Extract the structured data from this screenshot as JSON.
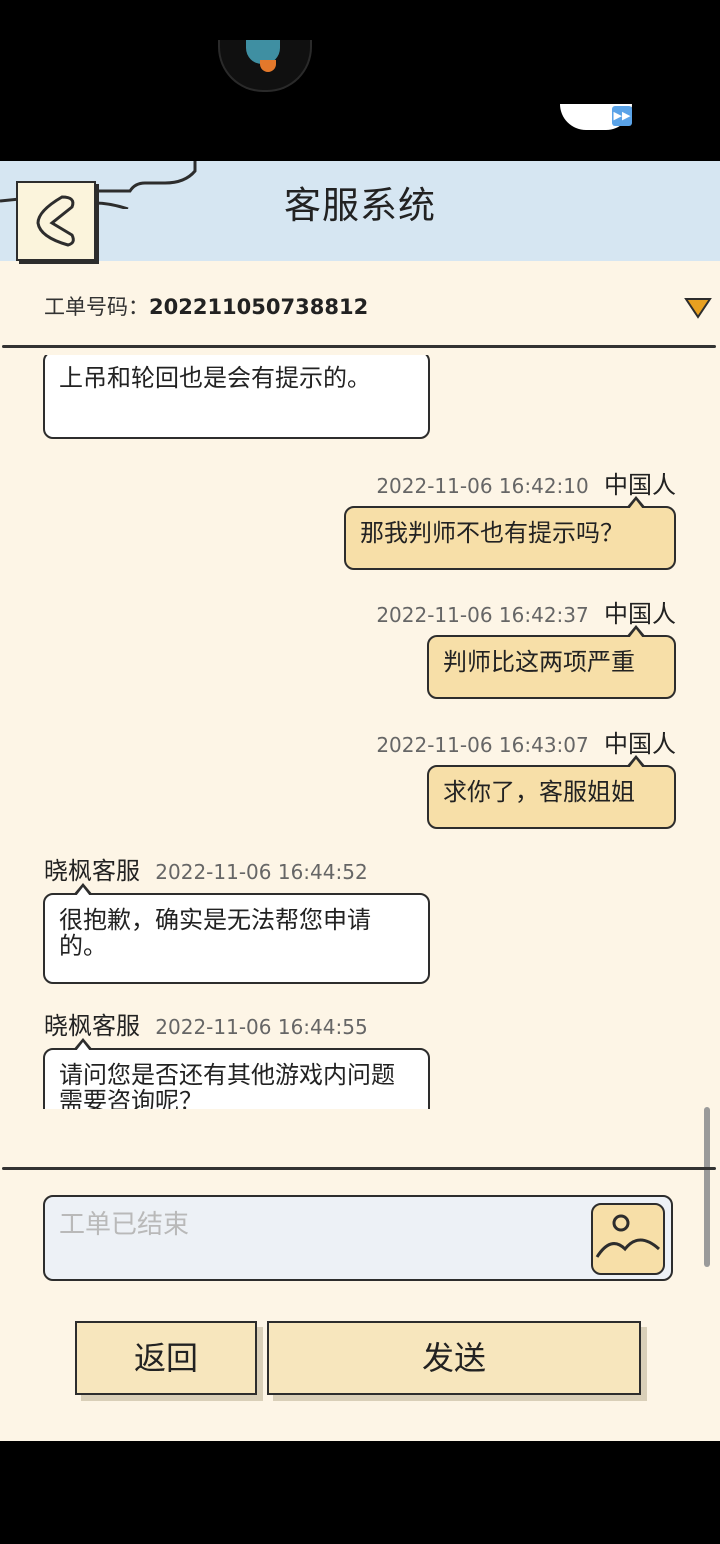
{
  "header": {
    "title": "客服系统"
  },
  "ticket": {
    "label": "工单号码：",
    "number": "202211050738812"
  },
  "messages": [
    {
      "side": "left",
      "text": "上吊和轮回也是会有提示的。"
    },
    {
      "side": "right",
      "sender": "中国人",
      "time": "2022-11-06 16:42:10",
      "text": "那我判师不也有提示吗？"
    },
    {
      "side": "right",
      "sender": "中国人",
      "time": "2022-11-06 16:42:37",
      "text": "判师比这两项严重"
    },
    {
      "side": "right",
      "sender": "中国人",
      "time": "2022-11-06 16:43:07",
      "text": "求你了，客服姐姐"
    },
    {
      "side": "left",
      "sender": "晓枫客服",
      "time": "2022-11-06 16:44:52",
      "text": "很抱歉，确实是无法帮您申请的。"
    },
    {
      "side": "left",
      "sender": "晓枫客服",
      "time": "2022-11-06 16:44:55",
      "text": "请问您是否还有其他游戏内问题需要咨询呢？"
    }
  ],
  "input": {
    "placeholder": "工单已结束"
  },
  "buttons": {
    "back": "返回",
    "send": "发送"
  },
  "icons": {
    "back": "back-arrow-icon",
    "dropdown": "dropdown-triangle-icon",
    "image": "image-icon",
    "fast_forward": "fast-forward-icon"
  },
  "colors": {
    "header_bg": "#d6e6f2",
    "panel_bg": "#fdf5e6",
    "user_bubble": "#f7dfa8",
    "dropdown": "#e8a020"
  }
}
